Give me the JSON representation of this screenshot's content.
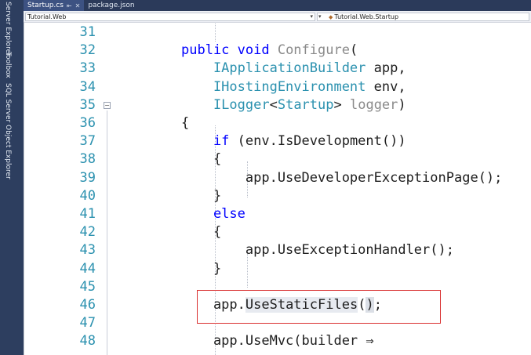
{
  "side_panels": [
    "Server Explorer",
    "Toolbox",
    "SQL Server Object Explorer"
  ],
  "tabs": [
    {
      "label": "Startup.cs",
      "pin_icon": "pin-icon",
      "close_icon": "close-icon",
      "active": true
    },
    {
      "label": "package.json",
      "active": false
    }
  ],
  "nav": {
    "project": "Tutorial.Web",
    "class": "Tutorial.Web.Startup"
  },
  "code_lines": [
    {
      "num": "31",
      "parts": []
    },
    {
      "num": "32",
      "parts": [
        {
          "t": "public void ",
          "c": "kw"
        },
        {
          "t": "Configure",
          "c": "dim"
        },
        {
          "t": "(",
          "c": "ident"
        }
      ]
    },
    {
      "num": "33",
      "parts": [
        {
          "t": "    IApplicationBuilder",
          "c": "type"
        },
        {
          "t": " app,",
          "c": "ident"
        }
      ]
    },
    {
      "num": "34",
      "parts": [
        {
          "t": "    IHostingEnvironment",
          "c": "type"
        },
        {
          "t": " env,",
          "c": "ident"
        }
      ]
    },
    {
      "num": "35",
      "parts": [
        {
          "t": "    ILogger",
          "c": "type"
        },
        {
          "t": "<",
          "c": "ident"
        },
        {
          "t": "Startup",
          "c": "type"
        },
        {
          "t": "> ",
          "c": "ident"
        },
        {
          "t": "logger",
          "c": "dim"
        },
        {
          "t": ")",
          "c": "ident"
        }
      ]
    },
    {
      "num": "36",
      "parts": [
        {
          "t": "{",
          "c": "ident"
        }
      ]
    },
    {
      "num": "37",
      "parts": [
        {
          "t": "    if",
          "c": "kw"
        },
        {
          "t": " (env.IsDevelopment())",
          "c": "ident"
        }
      ]
    },
    {
      "num": "38",
      "parts": [
        {
          "t": "    {",
          "c": "ident"
        }
      ]
    },
    {
      "num": "39",
      "parts": [
        {
          "t": "        app.UseDeveloperExceptionPage();",
          "c": "ident"
        }
      ]
    },
    {
      "num": "40",
      "parts": [
        {
          "t": "    }",
          "c": "ident"
        }
      ]
    },
    {
      "num": "41",
      "parts": [
        {
          "t": "    else",
          "c": "kw"
        }
      ]
    },
    {
      "num": "42",
      "parts": [
        {
          "t": "    {",
          "c": "ident"
        }
      ]
    },
    {
      "num": "43",
      "parts": [
        {
          "t": "        app.UseExceptionHandler();",
          "c": "ident"
        }
      ]
    },
    {
      "num": "44",
      "parts": [
        {
          "t": "    }",
          "c": "ident"
        }
      ]
    },
    {
      "num": "45",
      "parts": []
    },
    {
      "num": "46",
      "parts": [
        {
          "t": "    app.",
          "c": "ident"
        },
        {
          "t": "UseStaticFiles",
          "c": "ident ref-hl"
        },
        {
          "t": "(",
          "c": "ident"
        },
        {
          "t": ")",
          "c": "ident paren-hl"
        },
        {
          "t": ";",
          "c": "ident"
        }
      ]
    },
    {
      "num": "47",
      "parts": []
    },
    {
      "num": "48",
      "parts": [
        {
          "t": "    app.UseMvc(builder ⇒",
          "c": "ident"
        }
      ]
    }
  ]
}
